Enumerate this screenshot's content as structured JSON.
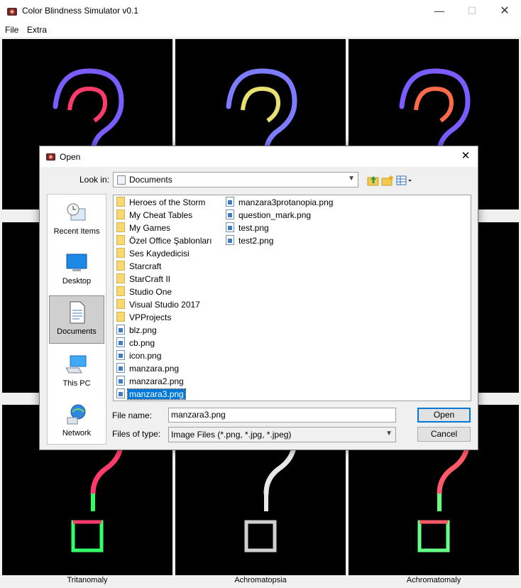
{
  "window": {
    "title": "Color Blindness Simulator v0.1"
  },
  "menu": {
    "items": [
      "File",
      "Extra"
    ]
  },
  "grid": {
    "bottom_labels": [
      "Tritanomaly",
      "Achromatopsia",
      "Achromatomaly"
    ]
  },
  "dialog": {
    "title": "Open",
    "look_in_label": "Look in:",
    "look_in_value": "Documents",
    "places": [
      "Recent Items",
      "Desktop",
      "Documents",
      "This PC",
      "Network"
    ],
    "selected_place": "Documents",
    "files_col1": [
      {
        "name": "Heroes of the Storm",
        "type": "folder"
      },
      {
        "name": "My Cheat Tables",
        "type": "folder"
      },
      {
        "name": "My Games",
        "type": "folder"
      },
      {
        "name": "Özel Office Şablonları",
        "type": "folder"
      },
      {
        "name": "Ses Kaydedicisi",
        "type": "folder"
      },
      {
        "name": "Starcraft",
        "type": "folder"
      },
      {
        "name": "StarCraft II",
        "type": "folder"
      },
      {
        "name": "Studio One",
        "type": "folder"
      },
      {
        "name": "Visual Studio 2017",
        "type": "folder"
      },
      {
        "name": "VPProjects",
        "type": "folder"
      },
      {
        "name": "blz.png",
        "type": "png"
      },
      {
        "name": "cb.png",
        "type": "png"
      },
      {
        "name": "icon.png",
        "type": "png"
      },
      {
        "name": "manzara.png",
        "type": "png"
      },
      {
        "name": "manzara2.png",
        "type": "png"
      },
      {
        "name": "manzara3.png",
        "type": "png"
      }
    ],
    "files_col2": [
      {
        "name": "manzara3protanopia.png",
        "type": "png"
      },
      {
        "name": "question_mark.png",
        "type": "png"
      },
      {
        "name": "test.png",
        "type": "png"
      },
      {
        "name": "test2.png",
        "type": "png"
      }
    ],
    "selected_file": "manzara3.png",
    "file_name_label": "File name:",
    "file_name_value": "manzara3.png",
    "files_of_type_label": "Files of type:",
    "files_of_type_value": "Image Files (*.png, *.jpg, *.jpeg)",
    "open_label": "Open",
    "cancel_label": "Cancel"
  }
}
